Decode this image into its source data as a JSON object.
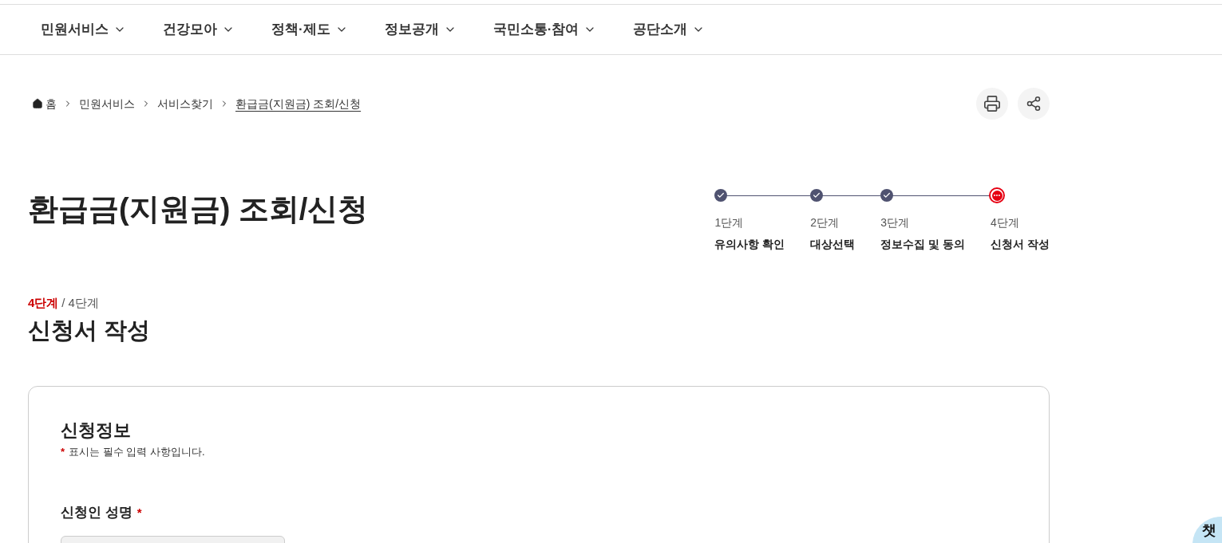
{
  "nav": {
    "items": [
      {
        "label": "민원서비스"
      },
      {
        "label": "건강모아"
      },
      {
        "label": "정책·제도"
      },
      {
        "label": "정보공개"
      },
      {
        "label": "국민소통·참여"
      },
      {
        "label": "공단소개"
      }
    ]
  },
  "breadcrumb": {
    "items": [
      {
        "label": "홈",
        "kind": "home"
      },
      {
        "label": "민원서비스",
        "kind": "link"
      },
      {
        "label": "서비스찾기",
        "kind": "link"
      },
      {
        "label": "환급금(지원금) 조회/신청",
        "kind": "current"
      }
    ]
  },
  "page_title": "환급금(지원금) 조회/신청",
  "steps": [
    {
      "label": "1단계",
      "title": "유의사항 확인",
      "completed": true
    },
    {
      "label": "2단계",
      "title": "대상선택",
      "completed": true
    },
    {
      "label": "3단계",
      "title": "정보수집 및 동의",
      "completed": true
    },
    {
      "label": "4단계",
      "title": "신청서 작성",
      "completed": false
    }
  ],
  "step_counter": {
    "current": "4단계",
    "separator": "/",
    "total": "4단계"
  },
  "section_title": "신청서 작성",
  "form": {
    "title": "신청정보",
    "required_mark": "*",
    "required_note": "표시는 필수 입력 사항입니다.",
    "fields": [
      {
        "label": "신청인 성명",
        "required": true
      }
    ]
  },
  "chat_badge": {
    "label": "챗"
  }
}
